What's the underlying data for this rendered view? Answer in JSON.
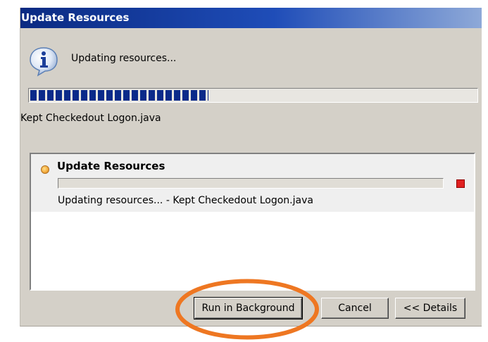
{
  "dialog": {
    "title": "Update Resources",
    "status": "Updating resources...",
    "progress": 0.4,
    "sub_status": "Kept Checkedout Logon.java",
    "icon": "info-icon",
    "title_colors": [
      "#0a2a82",
      "#8ea9d8"
    ]
  },
  "job": {
    "title": "Update Resources",
    "status": "Updating resources... - Kept Checkedout Logon.java",
    "progress": 0,
    "status_icon": "job-running-icon",
    "stop_icon": "stop-icon",
    "stop_color": "#e02020"
  },
  "buttons": {
    "run_in_background": "Run in Background",
    "cancel": "Cancel",
    "details": "<< Details"
  },
  "annotation": {
    "highlight_color": "#ee7722"
  }
}
